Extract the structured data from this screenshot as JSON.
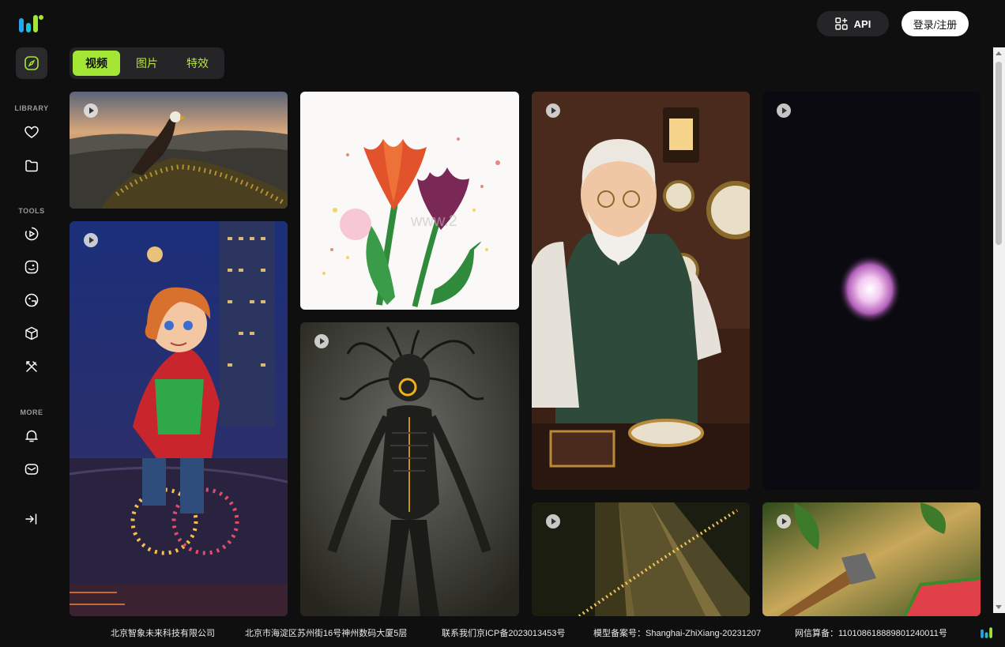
{
  "header": {
    "api_label": "API",
    "login_label": "登录/注册"
  },
  "tabs": [
    {
      "label": "视频",
      "active": true
    },
    {
      "label": "图片",
      "active": false
    },
    {
      "label": "特效",
      "active": false
    }
  ],
  "sidebar": {
    "section_library": "LIBRARY",
    "section_tools": "TOOLS",
    "section_more": "MORE",
    "icons": [
      "compass-icon",
      "heart-icon",
      "folder-icon",
      "video-play-icon",
      "face-icon",
      "face-edit-icon",
      "cube-icon",
      "tools-icon",
      "bell-icon",
      "mail-icon",
      "collapse-icon"
    ]
  },
  "watermark": "www.2",
  "footer": {
    "company": "北京智象未来科技有限公司",
    "address": "北京市海淀区苏州街16号神州数码大厦5层",
    "icp": "联系我们京ICP备2023013453号",
    "model_record": "模型备案号：Shanghai-ZhiXiang-20231207",
    "net_record": "网信算备：110108618889801240011号"
  },
  "colors": {
    "accent": "#a3e635",
    "background": "#0f0f10",
    "panel": "#252527"
  }
}
